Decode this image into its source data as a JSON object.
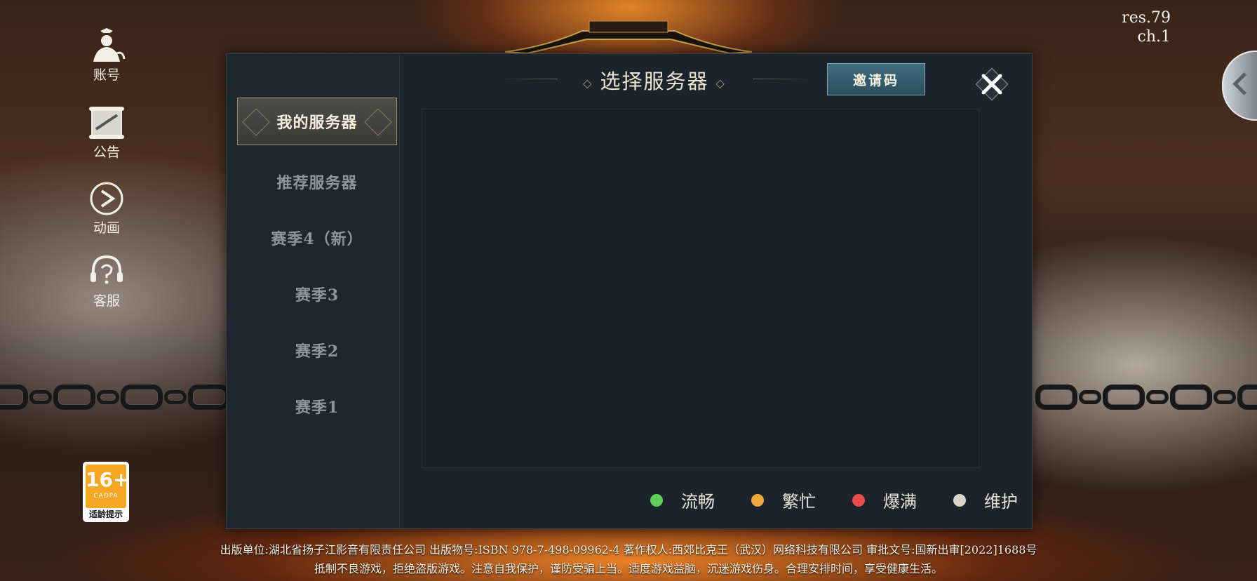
{
  "version": {
    "line1": "res.79",
    "line2": "ch.1"
  },
  "left_menu": [
    {
      "label": "账号",
      "icon": "account-icon"
    },
    {
      "label": "公告",
      "icon": "notice-scroll-icon"
    },
    {
      "label": "动画",
      "icon": "play-icon"
    },
    {
      "label": "客服",
      "icon": "customer-service-icon"
    }
  ],
  "dialog": {
    "title": "选择服务器",
    "invite_label": "邀请码",
    "close_icon": "close-icon",
    "tabs": [
      "我的服务器",
      "推荐服务器",
      "赛季4（新）",
      "赛季3",
      "赛季2",
      "赛季1"
    ],
    "active_tab": 0,
    "legend": [
      {
        "label": "流畅",
        "color": "#5fce5a"
      },
      {
        "label": "繁忙",
        "color": "#f0a93a"
      },
      {
        "label": "爆满",
        "color": "#ee4b4b"
      },
      {
        "label": "维护",
        "color": "#d8d6cc"
      }
    ]
  },
  "age_badge": {
    "rating": "16+",
    "org": "CADPA",
    "tip": "适龄提示"
  },
  "footer": {
    "line1": "出版单位:湖北省扬子江影音有限责任公司 出版物号:ISBN 978-7-498-09962-4 著作权人:西郊比克王（武汉）网络科技有限公司 审批文号:国新出审[2022]1688号",
    "line2": "抵制不良游戏，拒绝盗版游戏。注意自我保护，谨防受骗上当。适度游戏益脑，沉迷游戏伤身。合理安排时间，享受健康生活。"
  },
  "colors": {
    "panel": "#1c232b",
    "accent_gold": "#a69467",
    "invite": "#3f6e7e"
  }
}
